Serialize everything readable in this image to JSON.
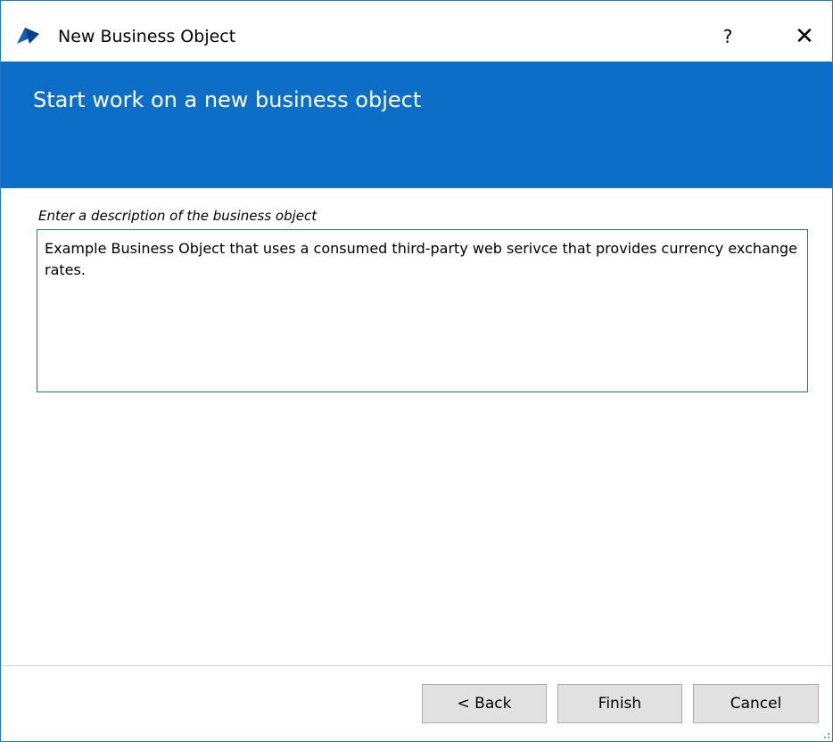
{
  "window": {
    "title": "New Business Object",
    "help_label": "?",
    "close_label": "✕"
  },
  "banner": {
    "title": "Start work on a new business object",
    "color": "#0c6ec7"
  },
  "description": {
    "label": "Enter a description of the business object",
    "value": "Example Business Object that uses a consumed third-party web serivce that provides currency exchange rates."
  },
  "buttons": {
    "back_label": "< Back",
    "finish_label": "Finish",
    "cancel_label": "Cancel"
  },
  "icons": {
    "app": "app-logo-icon",
    "help": "help-icon",
    "close": "close-icon",
    "resize": "resize-grip-icon"
  }
}
